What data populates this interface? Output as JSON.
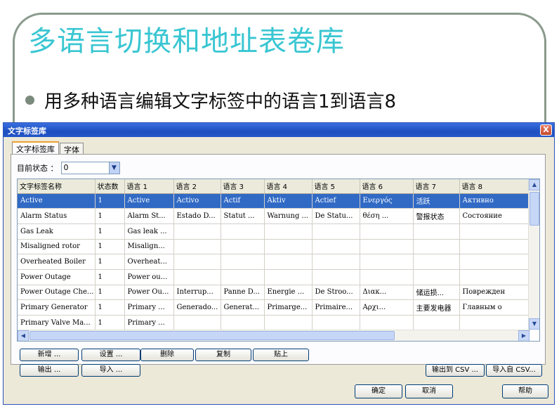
{
  "slide": {
    "title": "多语言切换和地址表卷库",
    "bullet": "用多种语言编辑文字标签中的语言1到语言8"
  },
  "dialog": {
    "title": "文字标签库",
    "close_symbol": "X",
    "tabs": [
      "文字标签库",
      "字体"
    ],
    "state_label": "目前状态 ：",
    "state_value": "0",
    "columns": [
      "文字标签名称",
      "状态数",
      "语言 1",
      "语言 2",
      "语言 3",
      "语言 4",
      "语言 5",
      "语言 6",
      "语言 7",
      "语言 8"
    ],
    "rows": [
      [
        "Active",
        "1",
        "Active",
        "Activo",
        "Actif",
        "Aktiv",
        "Actief",
        "Ενεργός",
        "活跃",
        "Активно"
      ],
      [
        "Alarm Status",
        "1",
        "Alarm St...",
        "Estado D...",
        "Statut ...",
        "Warnung ...",
        "De Statu...",
        "θέση ...",
        "警报状态",
        "Состояние"
      ],
      [
        "Gas Leak",
        "1",
        "Gas leak ...",
        "",
        "",
        "",
        "",
        "",
        "",
        ""
      ],
      [
        "Misaligned rotor",
        "1",
        "Misalign...",
        "",
        "",
        "",
        "",
        "",
        "",
        ""
      ],
      [
        "Overheated Boiler",
        "1",
        "Overheat...",
        "",
        "",
        "",
        "",
        "",
        "",
        ""
      ],
      [
        "Power Outage",
        "1",
        "Power ou...",
        "",
        "",
        "",
        "",
        "",
        "",
        ""
      ],
      [
        "Power Outage Che...",
        "1",
        "Power Ou...",
        "Interrup...",
        "Panne D...",
        "Energie ...",
        "De Stroo...",
        "Διακ...",
        "储运损...",
        "Поврежден"
      ],
      [
        "Primary Generator",
        "1",
        "Primary ...",
        "Generado...",
        "Generat...",
        "Primarge...",
        "Primaire...",
        "Αρχι...",
        "主要发电器",
        "Главным о"
      ],
      [
        "Primary Valve Ma...",
        "1",
        "Primary ...",
        "",
        "",
        "",
        "",
        "",
        "",
        ""
      ]
    ],
    "buttons": {
      "add": "新增 ...",
      "settings": "设置 ...",
      "delete": "删除",
      "copy": "复制",
      "paste": "贴上",
      "export": "输出 ...",
      "import": "导入 ...",
      "export_csv": "输出到 CSV ...",
      "import_csv": "导入自 CSV...",
      "ok": "确定",
      "cancel": "取消",
      "help": "帮助"
    },
    "icons": {
      "dropdown": "▼",
      "up": "▲",
      "down": "▼",
      "left": "◀",
      "right": "▶"
    }
  }
}
